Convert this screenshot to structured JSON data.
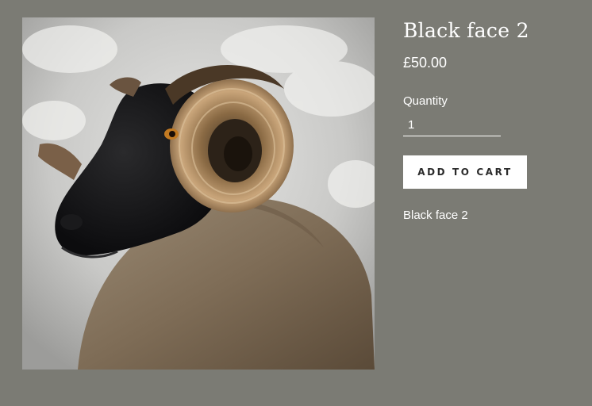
{
  "product": {
    "image_alt": "Black face 2",
    "title": "Black face 2",
    "price": "£50.00",
    "quantity_label": "Quantity",
    "quantity_value": "1",
    "add_to_cart_label": "ADD TO CART",
    "description": "Black face 2"
  },
  "colors": {
    "page_background": "#7b7b74",
    "text": "#ffffff",
    "button_background": "#ffffff",
    "button_text": "#2b2b2b"
  }
}
